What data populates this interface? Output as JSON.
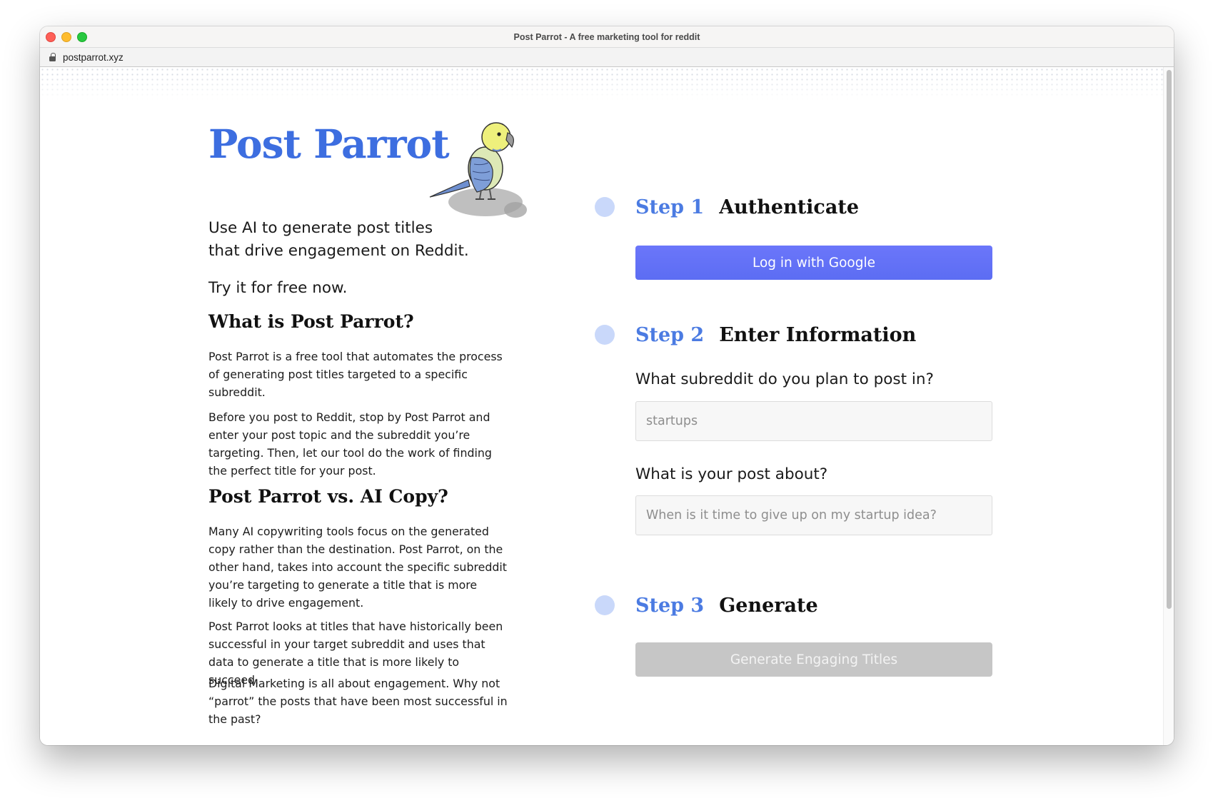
{
  "window": {
    "title": "Post Parrot - A free marketing tool for reddit",
    "url": "postparrot.xyz"
  },
  "hero": {
    "brand": "Post Parrot",
    "tagline_line1": "Use AI to generate post titles",
    "tagline_line2": "that drive engagement on Reddit.",
    "try_text": "Try it for free now."
  },
  "about": {
    "heading": "What is Post Parrot?",
    "paragraphs": [
      "Post Parrot is a free tool that automates the process of generating post titles targeted to a specific subreddit.",
      "Before you post to Reddit, stop by Post Parrot and enter your post topic and the subreddit you’re targeting. Then, let our tool do the work of finding the perfect title for your post."
    ]
  },
  "versus": {
    "heading": "Post Parrot vs. AI Copy?",
    "paragraphs": [
      "Many AI copywriting tools focus on the generated copy rather than the destination. Post Parrot, on the other hand, takes into account the specific subreddit you’re targeting to generate a title that is more likely to drive engagement.",
      "Post Parrot looks at titles that have historically been successful in your target subreddit and uses that data to generate a title that is more likely to succeed.",
      "Digital Marketing is all about engagement. Why not “parrot” the posts that have been most successful in the past?"
    ]
  },
  "steps": [
    {
      "number": "Step 1",
      "title": "Authenticate",
      "button": "Log in with Google"
    },
    {
      "number": "Step 2",
      "title": "Enter Information",
      "q1_label": "What subreddit do you plan to post in?",
      "q1_placeholder": "startups",
      "q2_label": "What is your post about?",
      "q2_placeholder": "When is it time to give up on my startup idea?"
    },
    {
      "number": "Step 3",
      "title": "Generate",
      "button": "Generate Engaging Titles"
    }
  ],
  "colors": {
    "brand_blue": "#3d6ee0",
    "button_blue": "#5c6df3",
    "step_dot": "#c9d8fa",
    "disabled_button": "#c6c6c6"
  }
}
